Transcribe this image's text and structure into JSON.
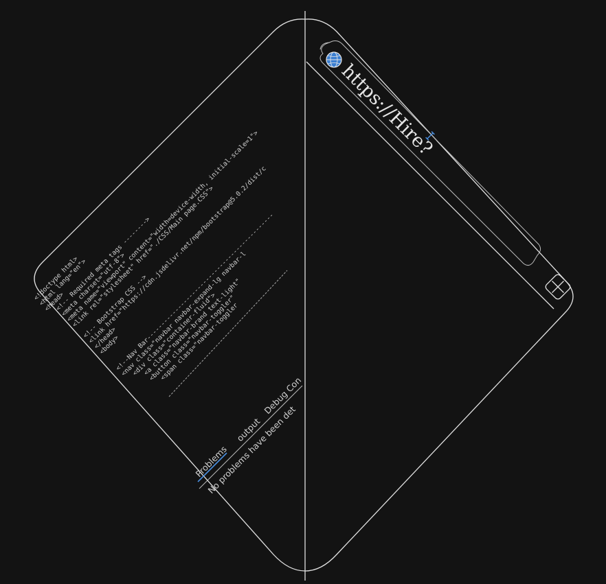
{
  "browser": {
    "url": "https://Hire?",
    "globe_color": "#3b7fd1",
    "accent_color": "#4a8fe0"
  },
  "editor": {
    "code_lines": [
      "<!doctype html>",
      "<html lang=\"en\">",
      "<head>",
      "<!-- Required meta tags -------->",
      "<meta charset=\"utf-8\">",
      "<meta name=\"viewport\" content=\"width=device-width, initial-scale=1\">",
      "<link rel=\"stylesheet\" href=\"./CSS/Main page.CSS\">",
      "",
      "<!-- Bootstrap CSS -->",
      "<link href=\"https://cdn.jsdelivr.net/npm/bootstrap@5.0.2/dist/c",
      "</head>",
      "<body>",
      "",
      "",
      "<!--Nav Bar---------------------------------------------",
      "<nav class=\"navbar navbar-expand-lg navbar-l",
      "<div class=\"container-fluid\">",
      "<a class=\"navbar-brand text-light\"",
      "<button class=\"navbar-toggler\"",
      "<span class=\"navbar-toggler"
    ]
  },
  "panel": {
    "tabs": [
      "Problems",
      "output",
      "Debug Con"
    ],
    "active_tab_color": "#4a8fe0",
    "message": "No problems have been det"
  }
}
